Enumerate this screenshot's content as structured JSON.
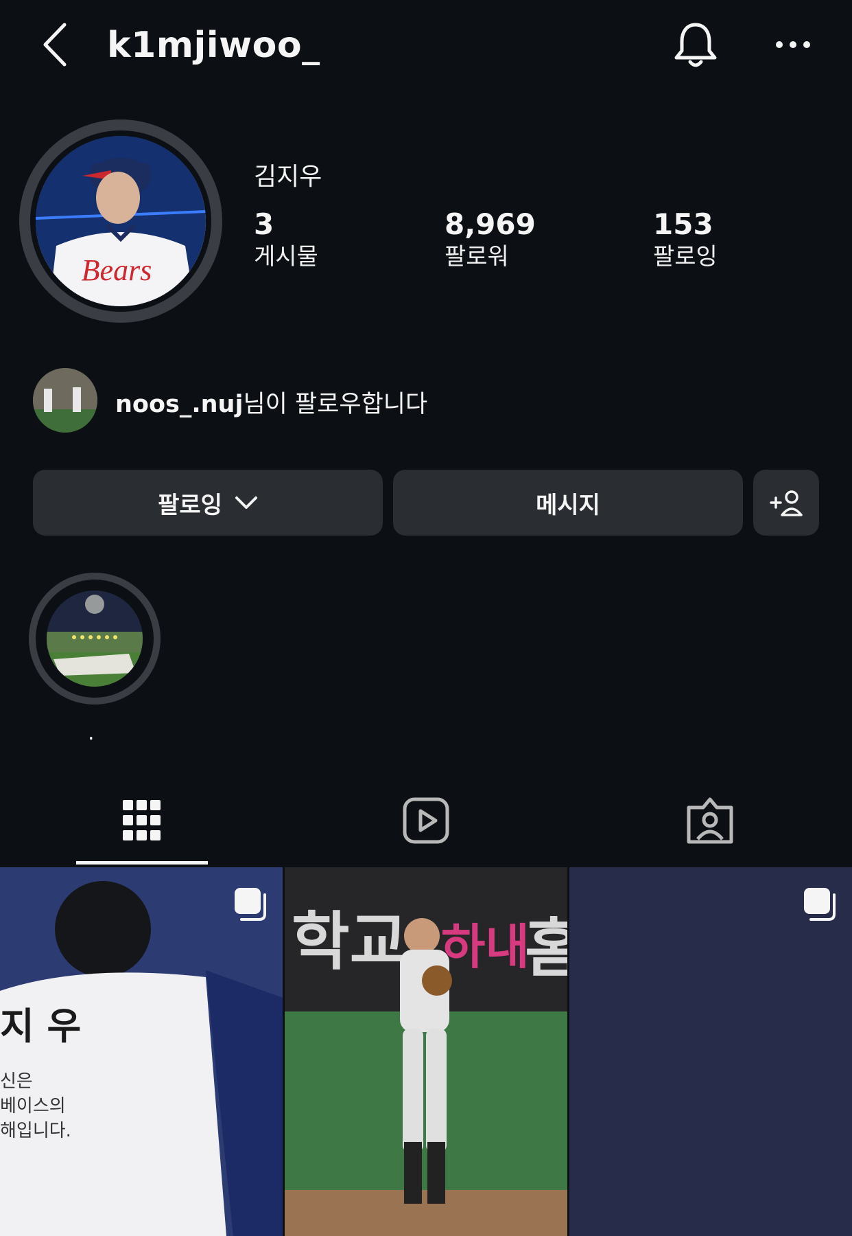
{
  "header": {
    "username": "k1mjiwoo_",
    "back_icon": "chevron-left-icon",
    "bell_icon": "bell-icon",
    "more_icon": "more-horizontal-icon"
  },
  "profile": {
    "full_name": "김지우",
    "stats": [
      {
        "value": "3",
        "label": "게시물"
      },
      {
        "value": "8,969",
        "label": "팔로워"
      },
      {
        "value": "153",
        "label": "팔로잉"
      }
    ]
  },
  "followed_by": {
    "username": "noos_.nuj",
    "suffix": "님이 팔로우합니다"
  },
  "buttons": {
    "following": "팔로잉",
    "message": "메시지"
  },
  "highlights": [
    {
      "label": "."
    }
  ],
  "tabs": [
    "grid-icon",
    "reels-icon",
    "tagged-icon"
  ],
  "colors": {
    "background": "#0c0f14",
    "button": "#2a2d32",
    "text": "#f5f5f5"
  }
}
